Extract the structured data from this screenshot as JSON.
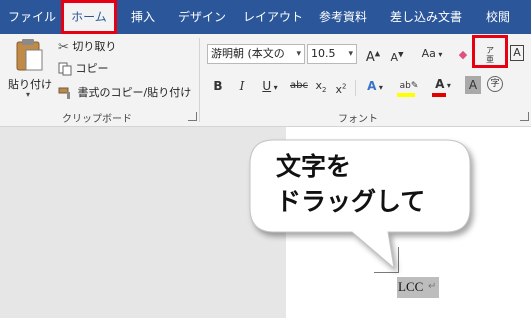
{
  "tabs": [
    {
      "label": "ファイル",
      "active": false
    },
    {
      "label": "ホーム",
      "active": true
    },
    {
      "label": "挿入",
      "active": false
    },
    {
      "label": "デザイン",
      "active": false
    },
    {
      "label": "レイアウト",
      "active": false
    },
    {
      "label": "参考資料",
      "active": false
    },
    {
      "label": "差し込み文書",
      "active": false
    },
    {
      "label": "校閲",
      "active": false
    }
  ],
  "clipboard": {
    "paste_label": "貼り付け",
    "cut_label": "切り取り",
    "copy_label": "コピー",
    "format_painter_label": "書式のコピー/貼り付け",
    "group_label": "クリップボード"
  },
  "font": {
    "font_name": "游明朝 (本文の",
    "font_size": "10.5",
    "phonetic_guide_label": "ア亜",
    "change_case_label": "Aa",
    "enclose_char_label": "字",
    "group_label": "フォント"
  },
  "callout": {
    "line1": "文字を",
    "line2": "ドラッグして"
  },
  "document": {
    "selected_text": "LCC",
    "return_mark": "↵"
  },
  "colors": {
    "tab_bar": "#2b579a",
    "highlight_red": "#e60012",
    "highlighter_yellow": "#ffff00",
    "font_color_red": "#e00000"
  }
}
